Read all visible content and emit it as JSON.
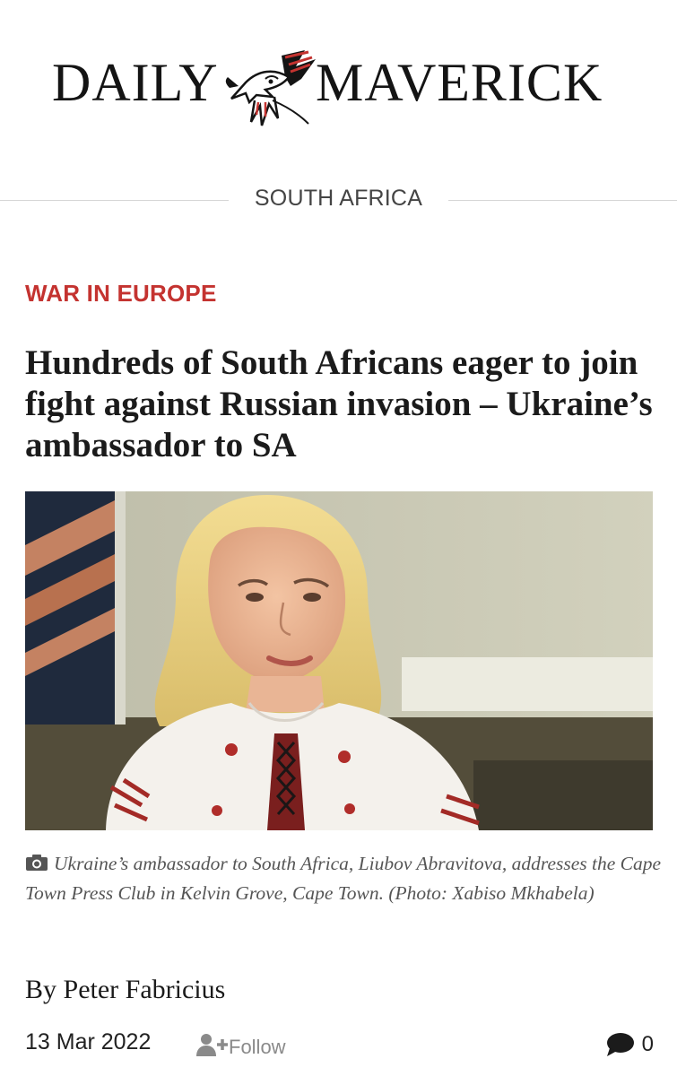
{
  "masthead": {
    "left_word": "DAILY",
    "right_word": "MAVERICK",
    "logo_icon": "maverick-bird-logo-icon"
  },
  "section": {
    "label": "SOUTH AFRICA"
  },
  "article": {
    "kicker": "WAR IN EUROPE",
    "headline": "Hundreds of South Africans eager to join fight against Russian invasion – Ukraine’s ambassador to SA",
    "caption": "Ukraine’s ambassador to South Africa, Liubov Abravitova, addresses the Cape Town Press Club in Kelvin Grove, Cape Town. (Photo: Xabiso Mkhabela)",
    "caption_icon": "camera-icon",
    "byline": "By Peter Fabricius",
    "date": "13 Mar 2022",
    "follow_label": "Follow",
    "follow_icon": "add-user-icon",
    "comment_icon": "speech-bubble-icon",
    "comment_count": "0"
  },
  "colors": {
    "kicker_red": "#c43330",
    "text_dark": "#1b1b1b",
    "muted_gray": "#8a8a8a"
  }
}
